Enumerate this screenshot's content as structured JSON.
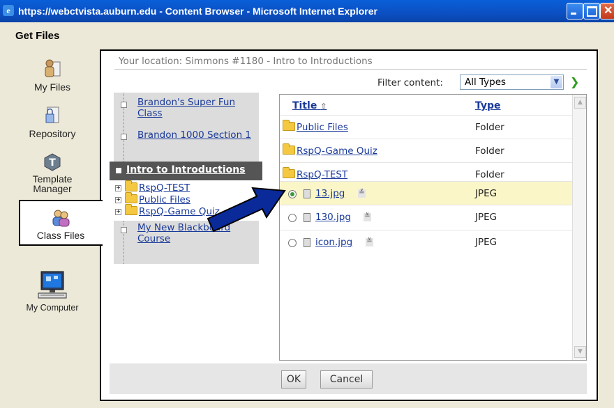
{
  "window": {
    "title": "https://webctvista.auburn.edu - Content Browser - Microsoft Internet Explorer"
  },
  "header": {
    "title": "Get Files"
  },
  "nav": {
    "items": [
      {
        "label": "My Files",
        "icon": "my-files-icon"
      },
      {
        "label": "Repository",
        "icon": "repository-icon"
      },
      {
        "label": "Template Manager",
        "icon": "template-manager-icon"
      },
      {
        "label": "Class Files",
        "icon": "class-files-icon",
        "active": true
      },
      {
        "label": "My Computer",
        "icon": "my-computer-icon"
      }
    ]
  },
  "location": {
    "text": "Your location: Simmons #1180 - Intro to Introductions"
  },
  "filter": {
    "label": "Filter content:",
    "value": "All Types"
  },
  "tree": {
    "courses_top": [
      "Brandon's Super Fun Class",
      "Brandon 1000 Section 1"
    ],
    "selected": "Intro to Introductions",
    "folders": [
      "RspQ-TEST",
      "Public Files",
      "RspQ-Game Quiz"
    ],
    "courses_bottom": [
      "My New Blackboard Course"
    ]
  },
  "list": {
    "headers": {
      "title": "Title",
      "type": "Type"
    },
    "rows": [
      {
        "name": "Public Files",
        "type": "Folder",
        "kind": "folder"
      },
      {
        "name": "RspQ-Game Quiz",
        "type": "Folder",
        "kind": "folder"
      },
      {
        "name": "RspQ-TEST",
        "type": "Folder",
        "kind": "folder"
      },
      {
        "name": "13.jpg",
        "type": "JPEG",
        "kind": "file",
        "selected": true
      },
      {
        "name": "130.jpg",
        "type": "JPEG",
        "kind": "file"
      },
      {
        "name": "icon.jpg",
        "type": "JPEG",
        "kind": "file"
      }
    ]
  },
  "buttons": {
    "ok": "OK",
    "cancel": "Cancel"
  },
  "colors": {
    "titlebar": "#0b4fc2",
    "highlight": "#fbf6c8",
    "link": "#1a3a9a",
    "arrow": "#0a2a9a"
  }
}
